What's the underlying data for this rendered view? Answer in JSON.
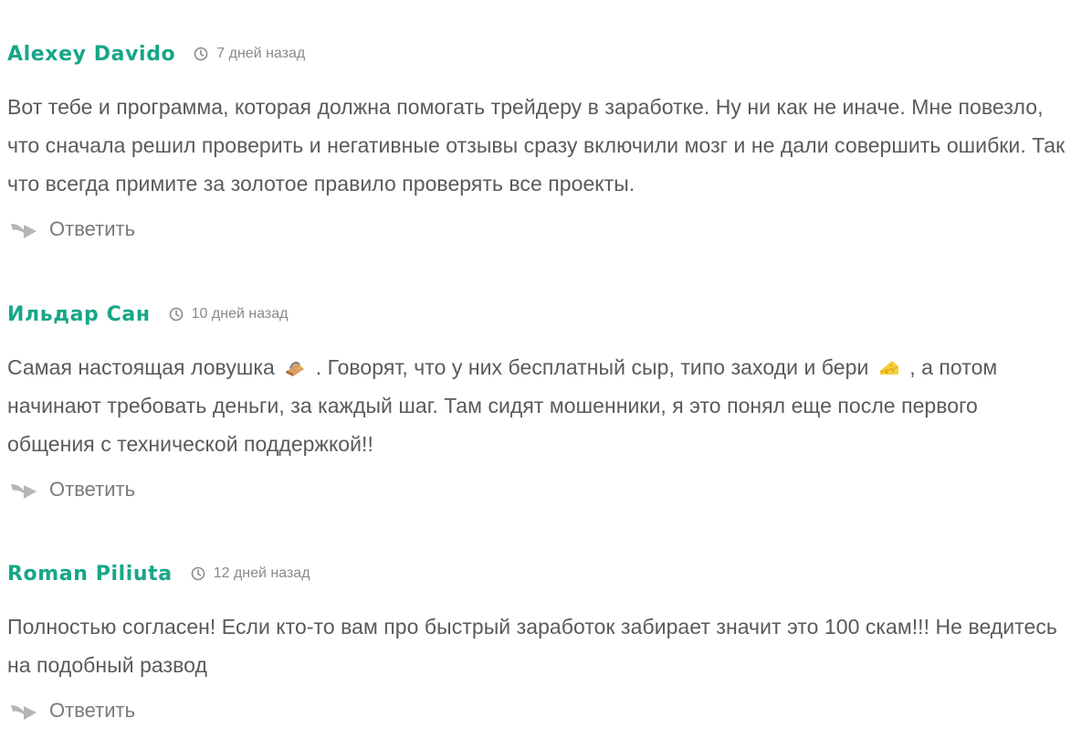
{
  "comments": [
    {
      "author": "Alexey Davido",
      "date": "7 дней назад",
      "text": "Вот тебе и программа, которая должна помогать трейдеру в заработке. Ну ни как не иначе. Мне повезло, что сначала решил проверить и негативные отзывы сразу включили мозг и не дали совершить ошибки. Так что всегда примите за золотое правило проверять все проекты.",
      "reply_label": "Ответить"
    },
    {
      "author": "Ильдар Сан",
      "date": "10 дней назад",
      "text_part1": "Самая настоящая ловушка",
      "emoji1": "mousetrap-emoji",
      "text_part2": ". Говорят, что у них бесплатный сыр, типо заходи и бери",
      "emoji2": "cheese-emoji",
      "text_part3": ", а потом начинают требовать деньги, за каждый шаг. Там сидят мошенники, я это понял еще после первого общения с технической поддержкой!!",
      "reply_label": "Ответить"
    },
    {
      "author": "Roman Piliuta",
      "date": "12 дней назад",
      "text": "Полностью согласен! Если кто-то вам про быстрый заработок забирает значит это 100 скам!!! Не ведитесь на подобный развод",
      "reply_label": "Ответить"
    }
  ],
  "colors": {
    "author": "#17a688",
    "text": "#5a5a5a",
    "date": "#8a8a8a",
    "icon": "#b5b5b5"
  },
  "icons": {
    "date": "clock-icon",
    "reply": "reply-arrow-icon"
  }
}
